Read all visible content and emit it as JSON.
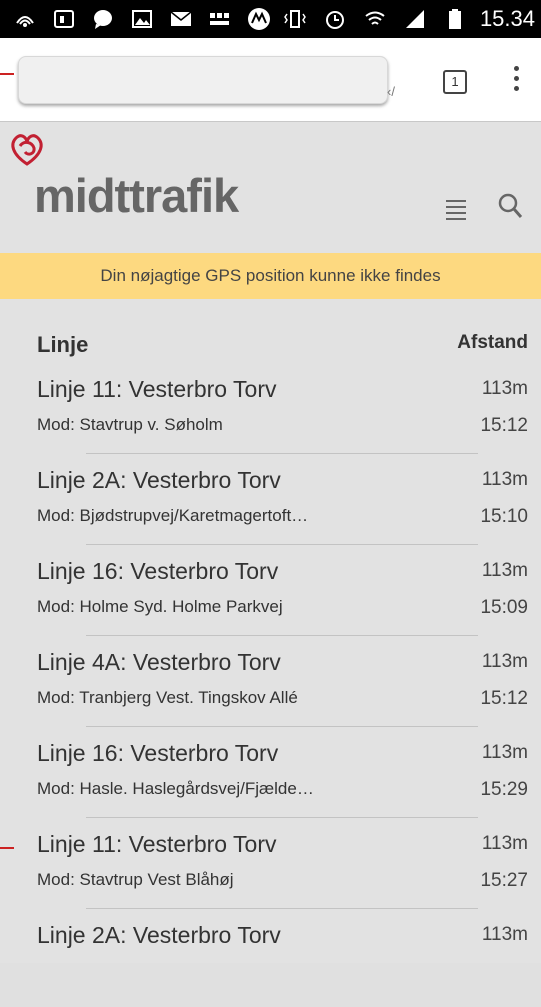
{
  "status_bar": {
    "time": "15.34",
    "left_icons": [
      "wifi-calling-icon",
      "screen-icon",
      "chat-bubble-icon",
      "gallery-icon",
      "email-icon",
      "bbc-news-icon",
      "motorola-icon"
    ],
    "right_icons": [
      "vibrate-icon",
      "alarm-icon",
      "wifi-icon",
      "signal-icon",
      "battery-icon"
    ]
  },
  "browser": {
    "url_tail": "‹/",
    "tab_count": "1"
  },
  "site": {
    "logo_text": "midttrafik",
    "brand_color": "#c22032",
    "gps_message": "Din nøjagtige GPS position kunne ikke findes",
    "banner_color": "#fdd980"
  },
  "list": {
    "header_left": "Linje",
    "header_right": "Afstand",
    "rows": [
      {
        "line": "Linje 11: Vesterbro Torv",
        "dist": "113m",
        "dest": "Mod: Stavtrup v. Søholm",
        "time": "15:12"
      },
      {
        "line": "Linje 2A: Vesterbro Torv",
        "dist": "113m",
        "dest": "Mod: Bjødstrupvej/Karetmagertoft…",
        "time": "15:10"
      },
      {
        "line": "Linje 16: Vesterbro Torv",
        "dist": "113m",
        "dest": "Mod: Holme Syd. Holme Parkvej",
        "time": "15:09"
      },
      {
        "line": "Linje 4A: Vesterbro Torv",
        "dist": "113m",
        "dest": "Mod: Tranbjerg Vest. Tingskov Allé",
        "time": "15:12"
      },
      {
        "line": "Linje 16: Vesterbro Torv",
        "dist": "113m",
        "dest": "Mod: Hasle. Haslegårdsvej/Fjælde…",
        "time": "15:29"
      },
      {
        "line": "Linje 11: Vesterbro Torv",
        "dist": "113m",
        "dest": "Mod: Stavtrup Vest Blåhøj",
        "time": "15:27"
      },
      {
        "line": "Linje 2A: Vesterbro Torv",
        "dist": "113m",
        "dest": "",
        "time": ""
      }
    ]
  }
}
